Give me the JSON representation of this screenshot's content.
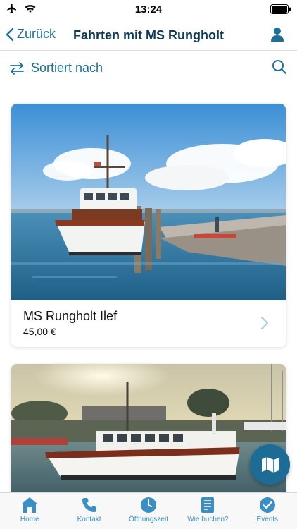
{
  "status_bar": {
    "time": "13:24",
    "icons": [
      "airplane-icon",
      "wifi-icon",
      "battery-icon"
    ]
  },
  "nav": {
    "back_label": "Zurück",
    "title": "Fahrten mit MS Rungholt",
    "profile_icon": "user-icon"
  },
  "toolbar": {
    "sort_label": "Sortiert nach",
    "sort_icon": "swap-arrows-icon",
    "search_icon": "search-icon"
  },
  "trips": [
    {
      "name": "MS Rungholt Ilef",
      "price": "45,00 €"
    },
    {
      "name": "",
      "price": ""
    }
  ],
  "map_button": {
    "icon": "map-icon"
  },
  "tabs": [
    {
      "label": "Home",
      "icon": "home-icon"
    },
    {
      "label": "Kontakt",
      "icon": "phone-icon"
    },
    {
      "label": "Öffnungszeit",
      "icon": "clock-icon"
    },
    {
      "label": "Wie buchen?",
      "icon": "booklet-icon"
    },
    {
      "label": "Events",
      "icon": "check-circle-icon"
    }
  ],
  "colors": {
    "accent": "#1d6f9a",
    "title": "#0f3a57",
    "tab_icon": "#3a8fc4",
    "fab": "#1c6c95"
  }
}
